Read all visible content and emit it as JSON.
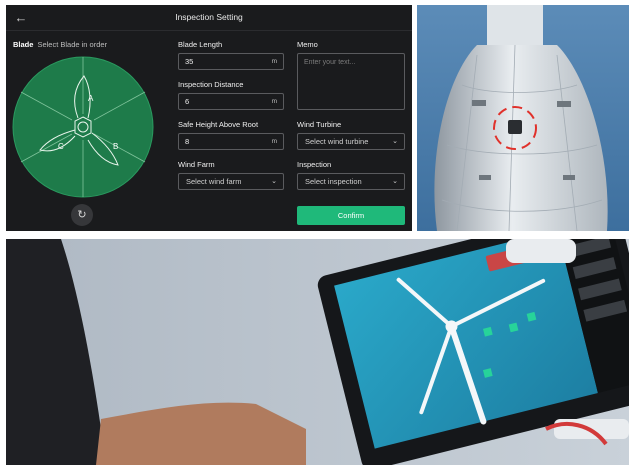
{
  "header": {
    "title": "Inspection Setting",
    "back_icon": "arrow-left-icon"
  },
  "blade": {
    "label": "Blade",
    "hint": "Select Blade in order",
    "segments": [
      "A",
      "B",
      "C"
    ],
    "disc_color": "#1e7b4a"
  },
  "form": {
    "blade_length": {
      "label": "Blade Length",
      "value": "35",
      "unit": "m"
    },
    "inspection_distance": {
      "label": "Inspection Distance",
      "value": "6",
      "unit": "m"
    },
    "safe_height": {
      "label": "Safe Height Above Root",
      "value": "8",
      "unit": "m"
    },
    "wind_farm": {
      "label": "Wind Farm",
      "placeholder": "Select wind farm"
    },
    "memo": {
      "label": "Memo",
      "placeholder": "Enter your text..."
    },
    "wind_turbine": {
      "label": "Wind Turbine",
      "placeholder": "Select wind turbine"
    },
    "inspection": {
      "label": "Inspection",
      "placeholder": "Select inspection"
    }
  },
  "confirm_label": "Confirm",
  "colors": {
    "accent": "#1fb97a",
    "panel_bg": "#1a1b1d",
    "target_ring": "#e0312b"
  }
}
